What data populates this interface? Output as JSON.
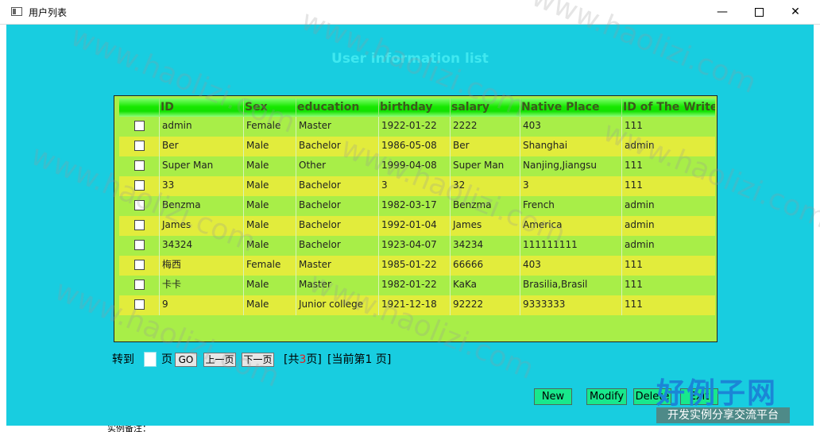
{
  "window": {
    "title": "用户列表",
    "min_glyph": "—",
    "close_glyph": "✕"
  },
  "page": {
    "heading": "User information list"
  },
  "grid": {
    "columns": [
      "ID",
      "Sex",
      "education",
      "birthday",
      "salary",
      "Native Place",
      "ID of The Writer"
    ],
    "rows": [
      [
        "admin",
        "Female",
        "Master",
        "1922-01-22",
        "2222",
        "403",
        "111"
      ],
      [
        "Ber",
        "Male",
        "Bachelor",
        "1986-05-08",
        "Ber",
        "Shanghai",
        "admin"
      ],
      [
        "Super Man",
        "Male",
        "Other",
        "1999-04-08",
        "Super Man",
        "Nanjing,Jiangsu",
        "111"
      ],
      [
        "33",
        "Male",
        "Bachelor",
        "3",
        "32",
        "3",
        "111"
      ],
      [
        "Benzma",
        "Male",
        "Bachelor",
        "1982-03-17",
        "Benzma",
        "French",
        "admin"
      ],
      [
        "James",
        "Male",
        "Bachelor",
        "1992-01-04",
        "James",
        "America",
        "admin"
      ],
      [
        "34324",
        "Male",
        "Bachelor",
        "1923-04-07",
        "34234",
        "111111111",
        "admin"
      ],
      [
        "梅西",
        "Female",
        "Master",
        "1985-01-22",
        "66666",
        "403",
        "111"
      ],
      [
        "卡卡",
        "Male",
        "Master",
        "1982-01-22",
        "KaKa",
        "Brasilia,Brasil",
        "111"
      ],
      [
        "9",
        "Male",
        "Junior college",
        "1921-12-18",
        "92222",
        "9333333",
        "111"
      ]
    ],
    "colors": {
      "even_row": "#a8ee48",
      "odd_row": "#e2ec3c",
      "header": "#17e800"
    }
  },
  "pager": {
    "goto_label": "转到",
    "page_label": "页",
    "go_button": "GO",
    "prev_button": "上一页",
    "next_button": "下一页",
    "total_prefix": "[共",
    "total_pages": "3",
    "total_suffix": "页]",
    "current_text": "[当前第1 页]"
  },
  "actions": {
    "new": "New",
    "modify": "Modify",
    "delete": "Delete",
    "exit": "Exit"
  },
  "watermark": {
    "text": "www.haolizi.com",
    "logo": "好例子网",
    "logo_sub": "开发实例分享交流平台"
  },
  "background_fragment": "实例备注：",
  "colors": {
    "client_bg": "#18cde0",
    "heading": "#3fe8f0",
    "action_button": "#18e88c",
    "logo": "#1b86d6"
  }
}
